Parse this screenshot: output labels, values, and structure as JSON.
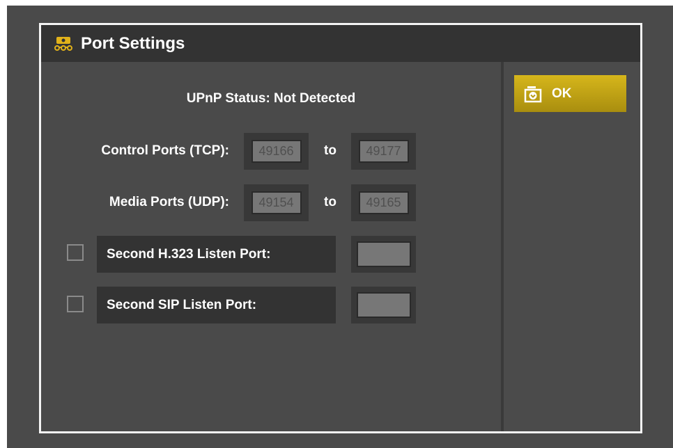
{
  "dialog": {
    "title": "Port Settings",
    "title_icon": "network-icon",
    "accent": "#d6b61b"
  },
  "upnp_status": "UPnP Status: Not Detected",
  "control_ports": {
    "label": "Control Ports (TCP):",
    "from": "49166",
    "to_word": "to",
    "to": "49177"
  },
  "media_ports": {
    "label": "Media Ports (UDP):",
    "from": "49154",
    "to_word": "to",
    "to": "49165"
  },
  "h323_listen": {
    "label": "Second H.323 Listen Port:",
    "value": "",
    "checked": false
  },
  "sip_listen": {
    "label": "Second SIP Listen Port:",
    "value": "",
    "checked": false
  },
  "ok_button": {
    "label": "OK",
    "icon": "ok-inbox-icon"
  }
}
